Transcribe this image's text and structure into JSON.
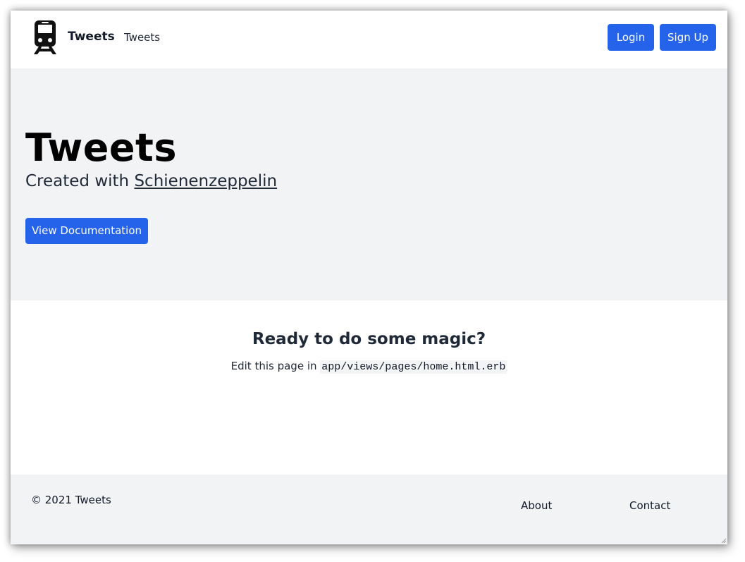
{
  "navbar": {
    "logo_icon": "train-icon",
    "brand": "Tweets",
    "links": [
      {
        "label": "Tweets"
      }
    ],
    "login_label": "Login",
    "signup_label": "Sign Up",
    "accent_color": "#2563eb"
  },
  "hero": {
    "title": "Tweets",
    "subtitle_prefix": "Created with",
    "subtitle_link": "Schienenzeppelin",
    "docs_button": "View Documentation",
    "background": "#f2f3f5"
  },
  "content": {
    "title": "Ready to do some magic?",
    "text_prefix": "Edit this page in",
    "code_path": "app/views/pages/home.html.erb"
  },
  "footer": {
    "copyright": "© 2021 Tweets",
    "links": [
      {
        "label": "About"
      },
      {
        "label": "Contact"
      }
    ]
  }
}
